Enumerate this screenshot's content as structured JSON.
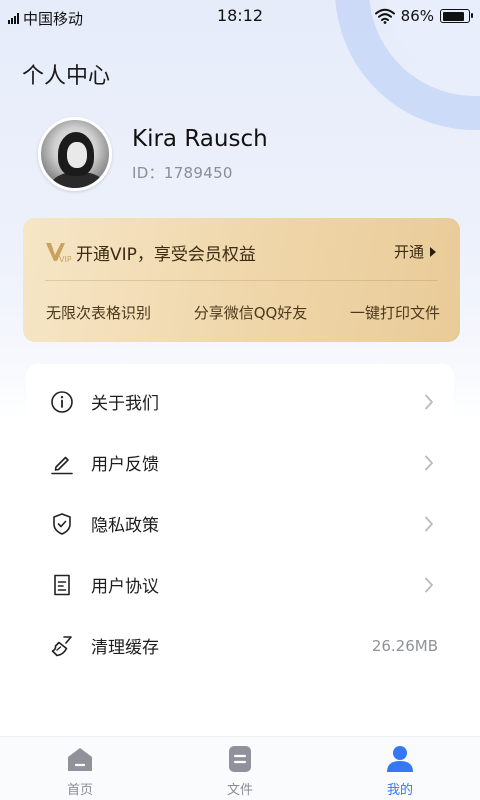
{
  "status_bar": {
    "carrier": "中国移动",
    "time": "18:12",
    "battery_text": "86%",
    "battery_level": 0.86
  },
  "page": {
    "title": "个人中心"
  },
  "profile": {
    "name": "Kira Rausch",
    "id_text": "ID：1789450"
  },
  "vip": {
    "logo_text": "VIP",
    "title": "开通VIP，享受会员权益",
    "open_label": "开通",
    "benefits": [
      "无限次表格识别",
      "分享微信QQ好友",
      "一键打印文件"
    ],
    "colors": {
      "card_start": "#f6e6c6",
      "card_end": "#e9cb98",
      "text": "#3a2b12"
    }
  },
  "menu": {
    "items": [
      {
        "label": "关于我们",
        "icon": "info-icon"
      },
      {
        "label": "用户反馈",
        "icon": "pencil-icon"
      },
      {
        "label": "隐私政策",
        "icon": "shield-check-icon"
      },
      {
        "label": "用户协议",
        "icon": "document-icon"
      },
      {
        "label": "清理缓存",
        "icon": "broom-icon",
        "value": "26.26MB"
      }
    ]
  },
  "tabbar": {
    "tabs": [
      {
        "label": "首页",
        "icon": "home-icon",
        "active": false
      },
      {
        "label": "文件",
        "icon": "file-icon",
        "active": false
      },
      {
        "label": "我的",
        "icon": "user-icon",
        "active": true
      }
    ],
    "colors": {
      "active": "#3578f6",
      "inactive": "#8a8d96"
    }
  }
}
